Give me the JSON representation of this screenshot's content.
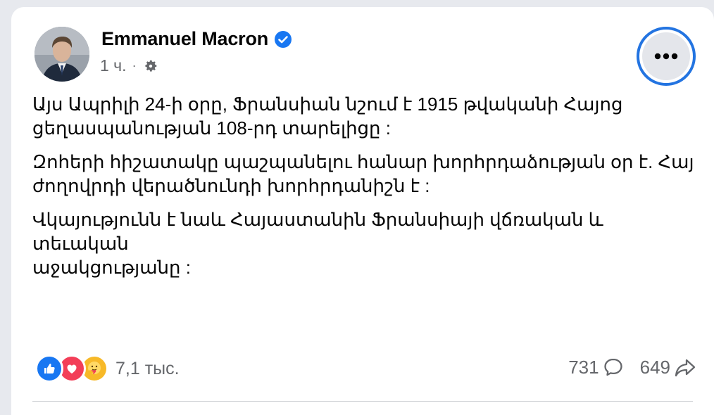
{
  "post": {
    "author": {
      "name": "Emmanuel Macron",
      "verified": true,
      "avatar": "profile-photo"
    },
    "meta": {
      "time": "1 ч.",
      "separator": "·",
      "audience_icon": "gear-icon"
    },
    "more_button_icon": "more-options-icon",
    "paragraphs": [
      "Այս Ապրիլի 24-ի օրը, Ֆրանսիան նշում է 1915 թվականի Հայոց\nցեղասպանության 108-րդ տարելիցը :",
      "Զոհերի հիշատակը պաշպանելու հանար խորհրդաձության օր է. Հայ\nժողովրդի վերածնունդի խորհրդանիշն է :",
      "Վկայությունն է նաև Հայաստանին Ֆրանսիայի վճռական և տեւական\nաջակցությանը :"
    ]
  },
  "reactions": {
    "icons": [
      "like-icon",
      "love-icon",
      "care-icon"
    ],
    "count": "7,1 тыс."
  },
  "stats": {
    "comments": "731",
    "shares": "649"
  },
  "colors": {
    "accent": "#2374e1",
    "like": "#1877f2",
    "love": "#f33e58",
    "care": "#f7b928",
    "secondary_text": "#65676b"
  }
}
